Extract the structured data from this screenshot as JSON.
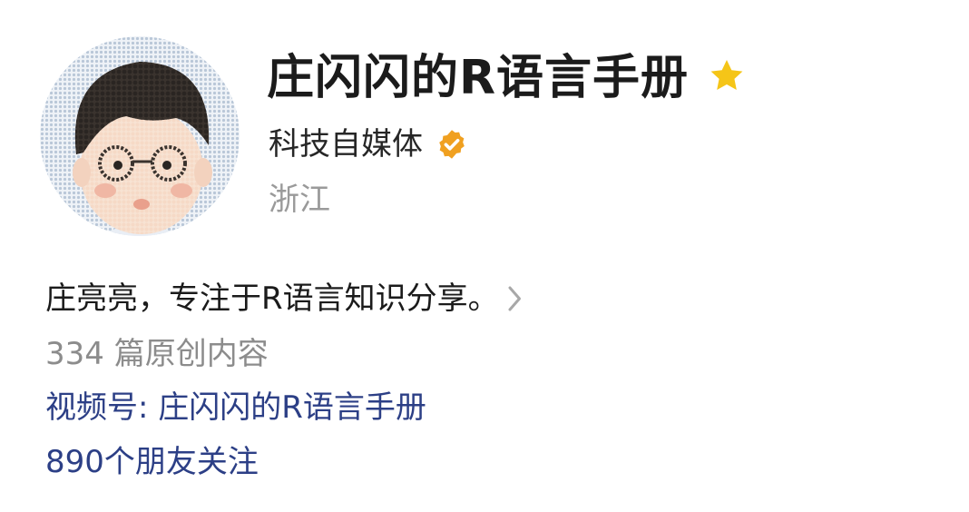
{
  "profile": {
    "name": "庄闪闪的R语言手册",
    "account_type": "科技自媒体",
    "region": "浙江",
    "bio": "庄亮亮，专注于R语言知识分享。",
    "articles": "334 篇原创内容",
    "video_channel": "视频号: 庄闪闪的R语言手册",
    "followers": "890个朋友关注"
  },
  "icons": {
    "avatar": "cartoon-avatar-with-glasses",
    "star": "star-icon",
    "verified": "verified-badge-icon",
    "chevron": "chevron-right-icon"
  },
  "colors": {
    "star": "#f5c518",
    "verified": "#f0a020",
    "link": "#2c3f86",
    "muted": "#9a9a9a"
  }
}
